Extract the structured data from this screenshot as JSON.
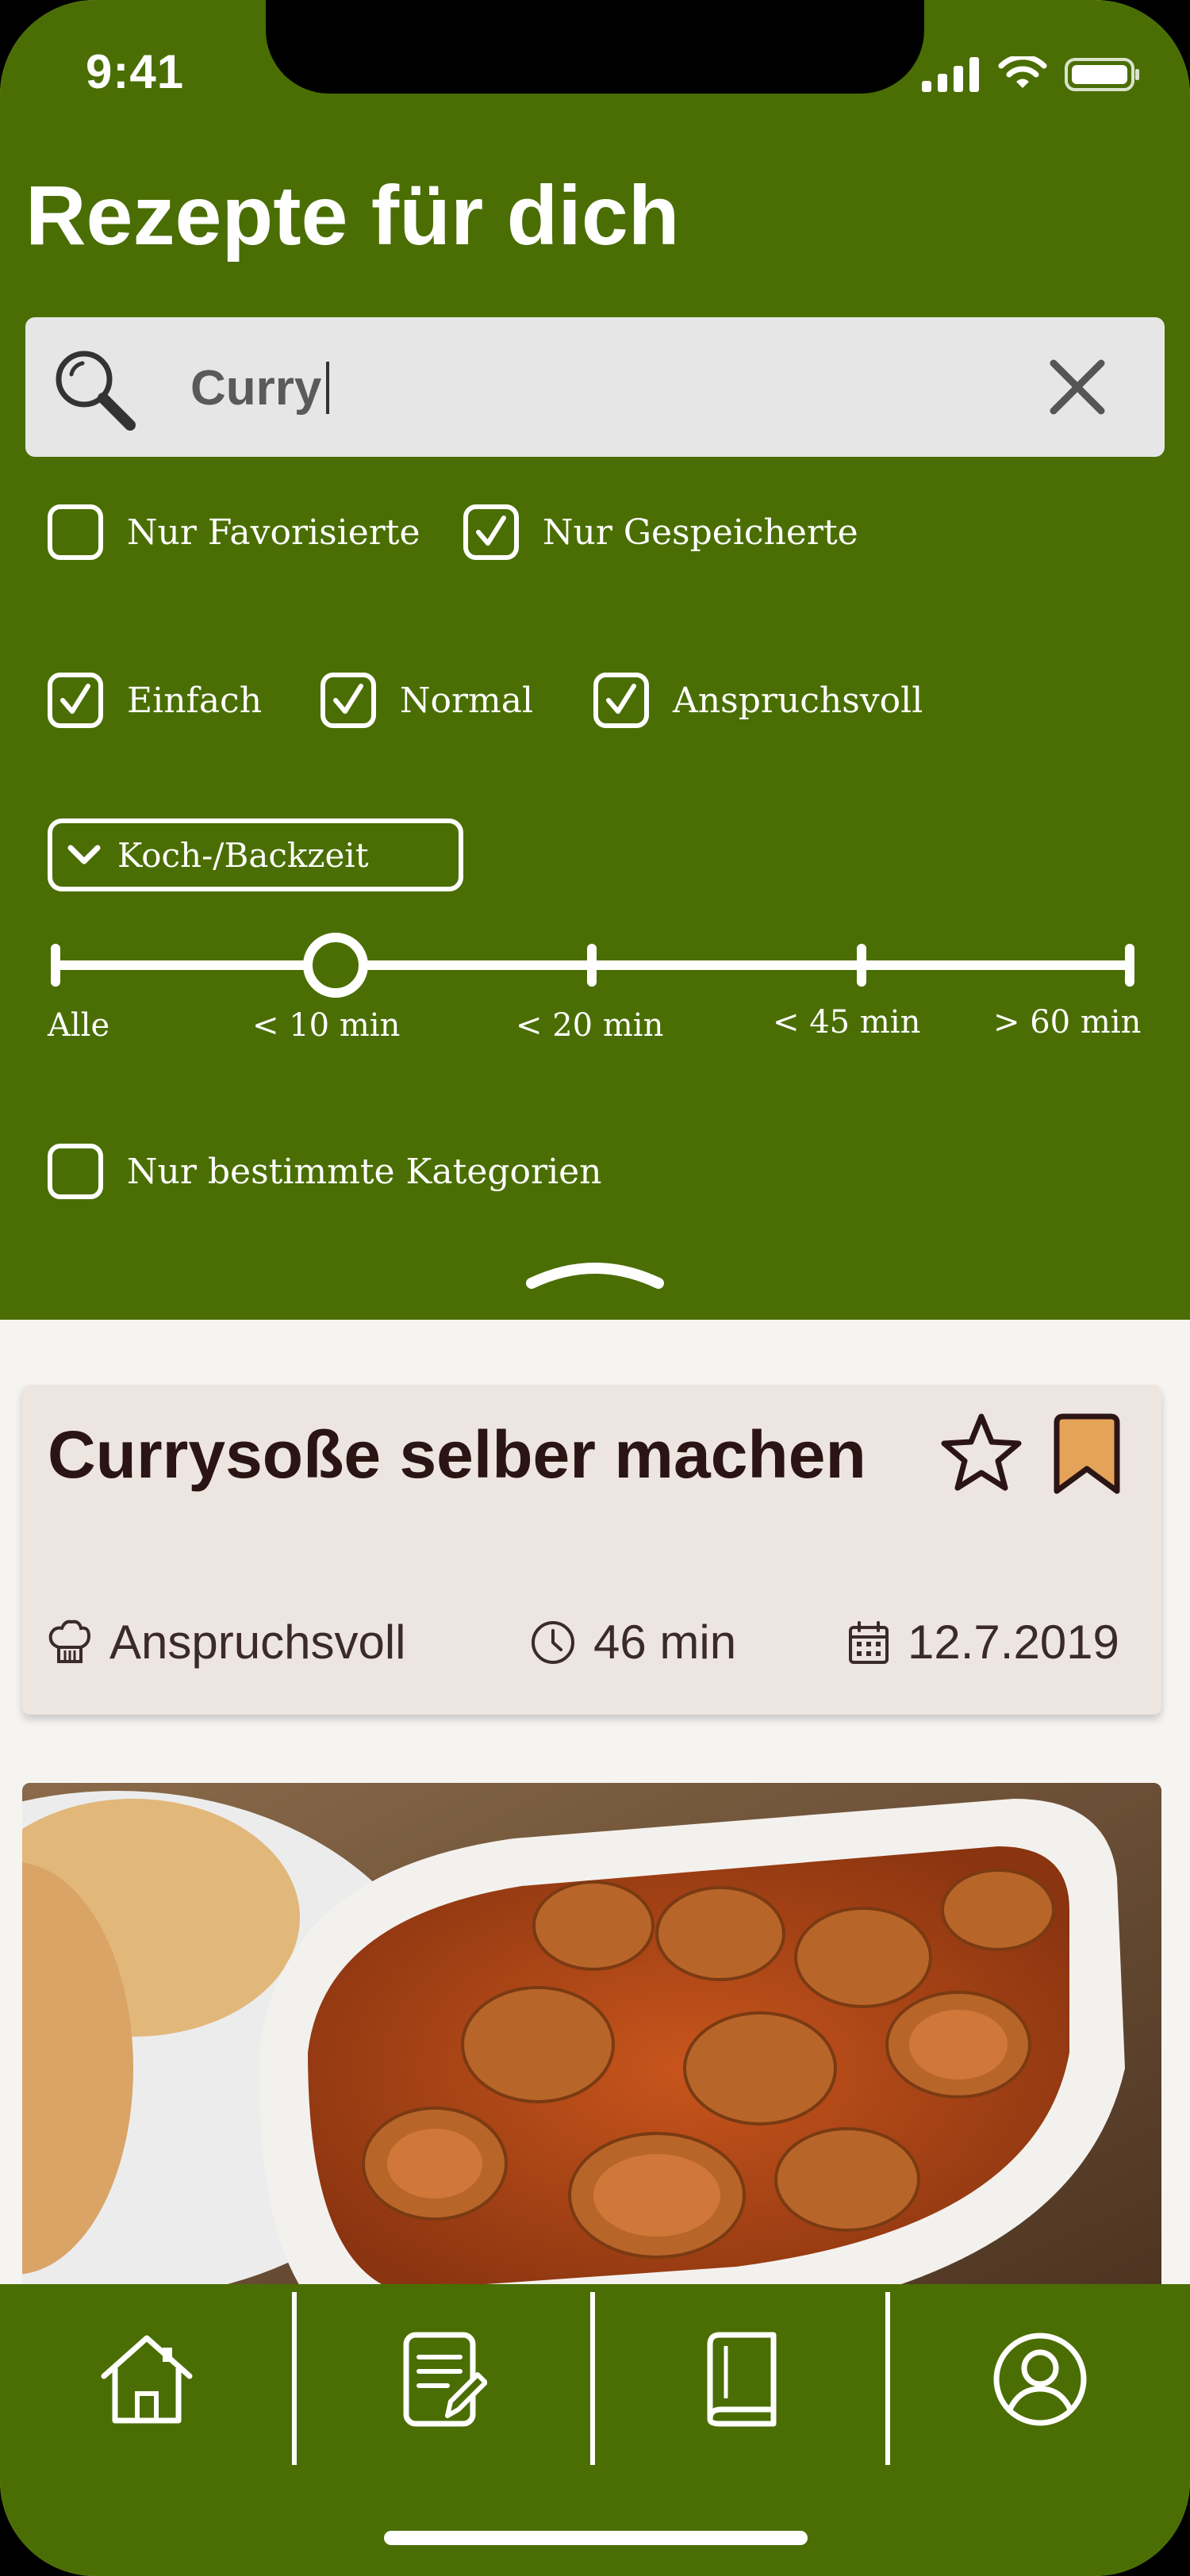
{
  "status_bar": {
    "time": "9:41"
  },
  "header": {
    "title": "Rezepte für dich"
  },
  "search": {
    "value": "Curry"
  },
  "filters": {
    "only_favorites": {
      "label": "Nur Favorisierte",
      "checked": false
    },
    "only_saved": {
      "label": "Nur Gespeicherte",
      "checked": true
    },
    "difficulty": [
      {
        "label": "Einfach",
        "checked": true
      },
      {
        "label": "Normal",
        "checked": true
      },
      {
        "label": "Anspruchsvoll",
        "checked": true
      }
    ],
    "time_dropdown_label": "Koch-/Backzeit",
    "time_slider": {
      "labels": [
        "Alle",
        "< 10 min",
        "< 20 min",
        "< 45 min",
        "> 60 min"
      ],
      "selected": "< 10 min"
    },
    "only_categories": {
      "label": "Nur bestimmte Kategorien",
      "checked": false
    }
  },
  "recipe_card": {
    "title": "Currysoße selber machen",
    "favorite": false,
    "saved": true,
    "difficulty": "Anspruchsvoll",
    "duration": "46 min",
    "date": "12.7.2019",
    "icons": {
      "difficulty": "chef-hat-icon",
      "duration": "clock-icon",
      "date": "calendar-icon"
    }
  },
  "tab_bar": {
    "items": [
      "home-icon",
      "notepad-icon",
      "book-icon",
      "profile-icon"
    ]
  },
  "colors": {
    "primary_green": "#4A6E03",
    "background": "#F6F4F1",
    "card": "#EDE5DF",
    "bookmark_orange": "#E5A35A",
    "title_dark": "#2A1414"
  }
}
